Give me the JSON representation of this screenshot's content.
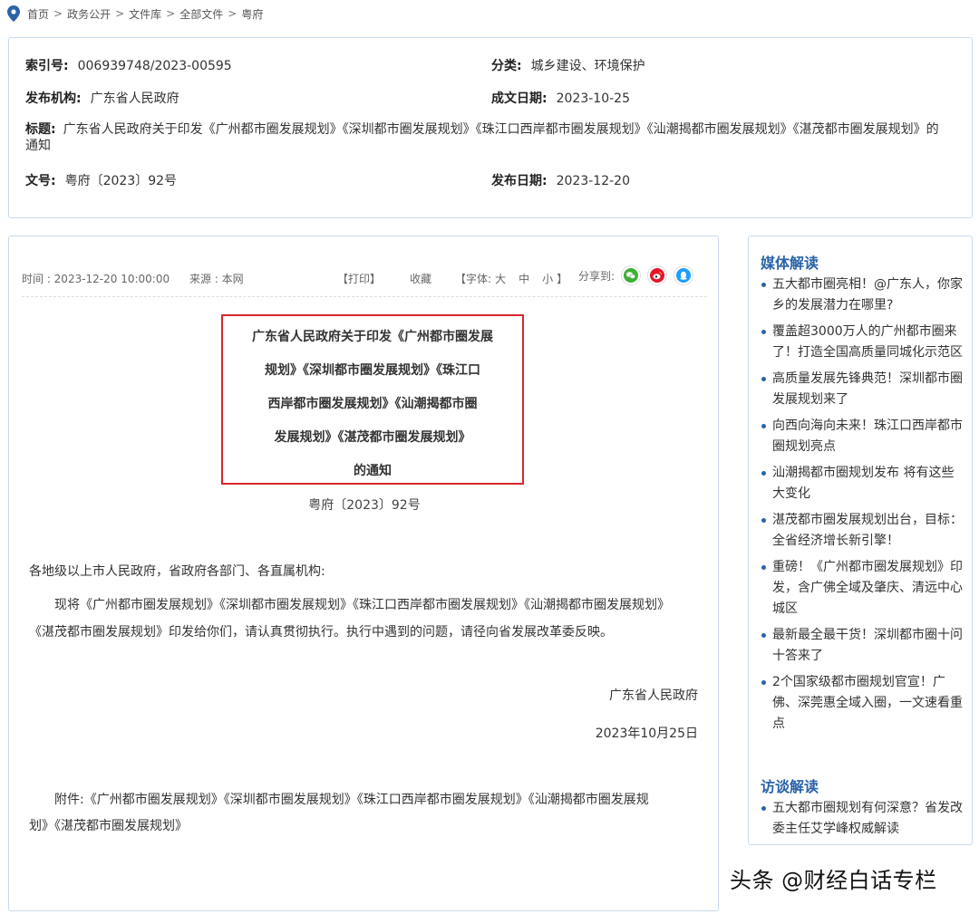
{
  "breadcrumb": [
    "首页",
    "政务公开",
    "文件库",
    "全部文件",
    "粤府"
  ],
  "meta": {
    "index_label": "索引号:",
    "index_value": "006939748/2023-00595",
    "category_label": "分类:",
    "category_value": "城乡建设、环境保护",
    "publisher_label": "发布机构:",
    "publisher_value": "广东省人民政府",
    "created_label": "成文日期:",
    "created_value": "2023-10-25",
    "title_label": "标题:",
    "title_value": "广东省人民政府关于印发《广州都市圈发展规划》《深圳都市圈发展规划》《珠江口西岸都市圈发展规划》《汕潮揭都市圈发展规划》《湛茂都市圈发展规划》的通知",
    "docno_label": "文号:",
    "docno_value": "粤府〔2023〕92号",
    "published_label": "发布日期:",
    "published_value": "2023-12-20"
  },
  "info": {
    "time": "时间 : 2023-12-20 10:00:00",
    "source": "来源 : 本网",
    "print": "【打印】",
    "favorite": "收藏",
    "font_open": "【字体:",
    "font_large": "大",
    "font_medium": "中",
    "font_small": "小",
    "font_close": "】",
    "share_label": "分享到:"
  },
  "article": {
    "title_lines": [
      "广东省人民政府关于印发《广州都市圈发展",
      "规划》《深圳都市圈发展规划》《珠江口",
      "西岸都市圈发展规划》《汕潮揭都市圈",
      "发展规划》《湛茂都市圈发展规划》",
      "的通知"
    ],
    "doc_number": "粤府〔2023〕92号",
    "salutation": "各地级以上市人民政府，省政府各部门、各直属机构:",
    "para1_line1": "现将《广州都市圈发展规划》《深圳都市圈发展规划》《珠江口西岸都市圈发展规划》《汕潮揭都市圈发展规划》",
    "para1_line2": "《湛茂都市圈发展规划》印发给你们，请认真贯彻执行。执行中遇到的问题，请径向省发展改革委反映。",
    "signature": "广东省人民政府",
    "sign_date": "2023年10月25日",
    "attach_line1": "附件:《广州都市圈发展规划》《深圳都市圈发展规划》《珠江口西岸都市圈发展规划》《汕潮揭都市圈发展规",
    "attach_line2": "划》《湛茂都市圈发展规划》"
  },
  "sidebar": {
    "media_heading": "媒体解读",
    "media_items": [
      "五大都市圈亮相！@广东人，你家乡的发展潜力在哪里?",
      "覆盖超3000万人的广州都市圈来了！打造全国高质量同城化示范区",
      "高质量发展先锋典范！深圳都市圈发展规划来了",
      "向西向海向未来！珠江口西岸都市圈规划亮点",
      "汕潮揭都市圈规划发布 将有这些大变化",
      "湛茂都市圈发展规划出台，目标：全省经济增长新引擎！",
      "重磅！《广州都市圈发展规划》印发，含广佛全域及肇庆、清远中心城区",
      "最新最全最干货！深圳都市圈十问十答来了",
      "2个国家级都市圈规划官宣！广佛、深莞惠全域入圈，一文速看重点"
    ],
    "interview_heading": "访谈解读",
    "interview_items": [
      "五大都市圈规划有何深意？省发改委主任艾学峰权威解读"
    ]
  },
  "watermark": "头条 @财经白话专栏",
  "colors": {
    "accent": "#2a63a8",
    "title_border": "#d9262c",
    "box_border": "#c9daec",
    "wechat": "#3cb034",
    "weibo": "#e6162d",
    "qq": "#1e9fff"
  },
  "icons": {
    "location": "location-pin-icon",
    "wechat": "wechat-icon",
    "weibo": "weibo-icon",
    "qq": "qq-icon"
  }
}
